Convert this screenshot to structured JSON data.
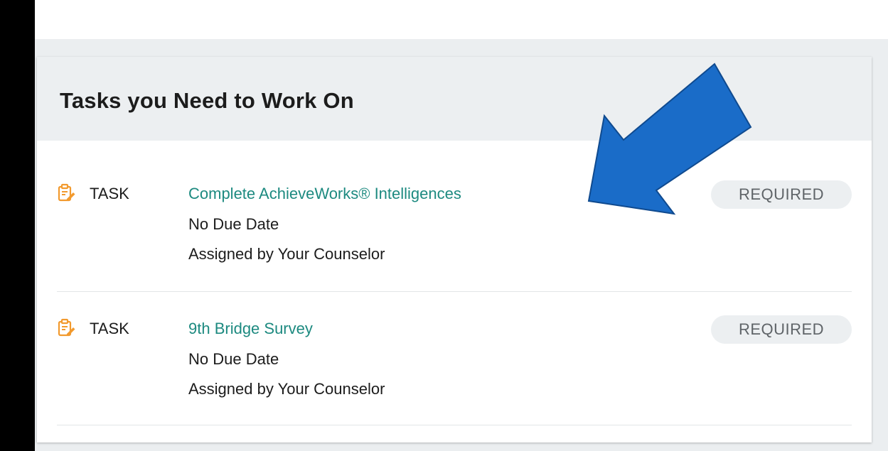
{
  "card": {
    "title": "Tasks you Need to Work On"
  },
  "tasks": [
    {
      "type": "TASK",
      "title": "Complete AchieveWorks® Intelligences",
      "due": "No Due Date",
      "assigned": "Assigned by Your Counselor",
      "badge": "REQUIRED",
      "icon": "clipboard-edit-icon"
    },
    {
      "type": "TASK",
      "title": "9th Bridge Survey",
      "due": "No Due Date",
      "assigned": "Assigned by Your Counselor",
      "badge": "REQUIRED",
      "icon": "clipboard-edit-icon"
    }
  ],
  "colors": {
    "link": "#1d8a80",
    "icon": "#f29a2e",
    "arrow_fill": "#1a6cc8",
    "arrow_stroke": "#0f4a8f",
    "badge_bg": "#eceff1"
  }
}
